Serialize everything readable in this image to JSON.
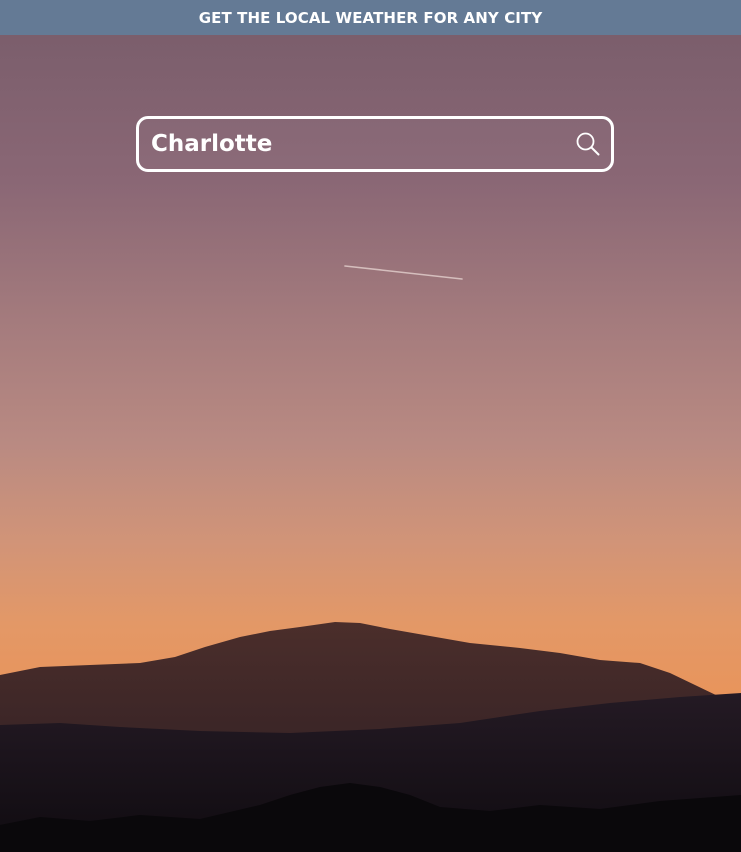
{
  "header": {
    "title": "GET THE LOCAL WEATHER FOR ANY CITY"
  },
  "search": {
    "value": "Charlotte",
    "icon": "search-icon"
  },
  "background": {
    "sky_top": "#7b5e6c",
    "sky_mid": "#b48580",
    "sky_low": "#e69a60",
    "mountain_far": "#4a2c2a",
    "ground_dark": "#150f16"
  }
}
